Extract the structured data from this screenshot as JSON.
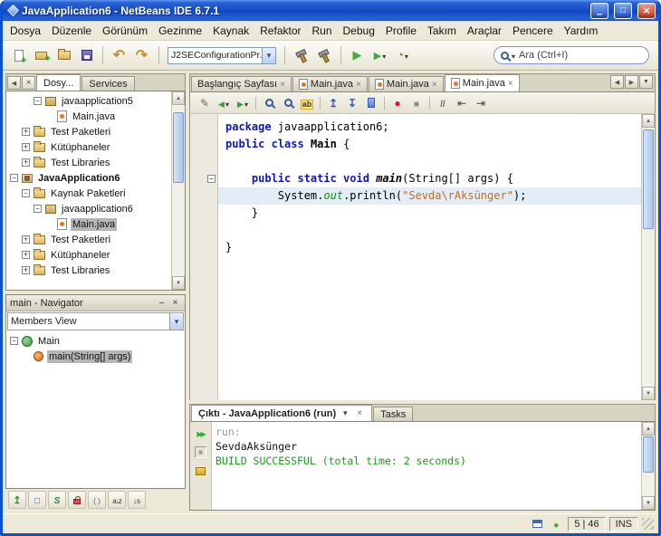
{
  "window": {
    "title": "JavaApplication6 - NetBeans IDE 6.7.1"
  },
  "menubar": [
    "Dosya",
    "Düzenle",
    "Görünüm",
    "Gezinme",
    "Kaynak",
    "Refaktor",
    "Run",
    "Debug",
    "Profile",
    "Takım",
    "Araçlar",
    "Pencere",
    "Yardım"
  ],
  "toolbar": {
    "config_value": "J2SEConfigurationPr...",
    "search_value": "Ara (Ctrl+I)",
    "buttons_left": [
      {
        "name": "new-file",
        "icon": "page-plus"
      },
      {
        "name": "new-project",
        "icon": "project-plus"
      },
      {
        "name": "open-project",
        "icon": "open-folder"
      },
      {
        "name": "save-all",
        "icon": "save"
      },
      {
        "sep": true
      },
      {
        "name": "undo",
        "icon": "undo"
      },
      {
        "name": "redo",
        "icon": "redo"
      }
    ],
    "buttons_right": [
      {
        "name": "build-project",
        "icon": "hammer"
      },
      {
        "name": "clean-build-project",
        "icon": "hammer2"
      },
      {
        "sep": true
      },
      {
        "name": "run-project",
        "icon": "run"
      },
      {
        "name": "debug-project",
        "icon": "debug",
        "arrow": true
      },
      {
        "name": "profile-project",
        "icon": "profile",
        "arrow": true
      }
    ]
  },
  "projects": {
    "tabs": [
      {
        "label": "Dosy...",
        "active": true
      },
      {
        "label": "Services",
        "active": false
      }
    ],
    "tree": [
      {
        "label": "javaapplication5",
        "icon": "pkg",
        "level": 2,
        "toggle": "minus"
      },
      {
        "label": "Main.java",
        "icon": "java",
        "level": 3
      },
      {
        "label": "Test Paketleri",
        "icon": "folder",
        "level": 1,
        "toggle": "plus"
      },
      {
        "label": "Kütüphaneler",
        "icon": "folder",
        "level": 1,
        "toggle": "plus"
      },
      {
        "label": "Test Libraries",
        "icon": "folder",
        "level": 1,
        "toggle": "plus"
      },
      {
        "label": "JavaApplication6",
        "icon": "project",
        "level": 0,
        "toggle": "minus",
        "bold": true
      },
      {
        "label": "Kaynak Paketleri",
        "icon": "folder",
        "level": 1,
        "toggle": "minus"
      },
      {
        "label": "javaapplication6",
        "icon": "pkg",
        "level": 2,
        "toggle": "minus"
      },
      {
        "label": "Main.java",
        "icon": "java",
        "level": 3,
        "selected": true
      },
      {
        "label": "Test Paketleri",
        "icon": "folder",
        "level": 1,
        "toggle": "plus"
      },
      {
        "label": "Kütüphaneler",
        "icon": "folder",
        "level": 1,
        "toggle": "plus"
      },
      {
        "label": "Test Libraries",
        "icon": "folder",
        "level": 1,
        "toggle": "plus"
      }
    ]
  },
  "navigator": {
    "title": "main - Navigator",
    "view": "Members View",
    "tree": [
      {
        "label": "Main",
        "icon": "class",
        "level": 0,
        "toggle": "minus"
      },
      {
        "label": "main(String[] args)",
        "icon": "method",
        "level": 1,
        "selected": true
      }
    ],
    "filters": [
      {
        "name": "show-inherited",
        "icon": "inherited"
      },
      {
        "name": "show-fields",
        "icon": "fields"
      },
      {
        "name": "show-static",
        "icon": "static"
      },
      {
        "name": "show-non-public",
        "icon": "lock"
      },
      {
        "name": "show-anonymous",
        "icon": "anon"
      },
      {
        "name": "sort-by-name",
        "icon": "sort-alpha"
      },
      {
        "name": "sort-by-source",
        "icon": "sort-pos"
      }
    ]
  },
  "editor": {
    "tabs": [
      {
        "label": "Başlangıç Sayfası",
        "icon": "none",
        "active": false
      },
      {
        "label": "Main.java",
        "icon": "java",
        "active": false
      },
      {
        "label": "Main.java",
        "icon": "java",
        "active": false
      },
      {
        "label": "Main.java",
        "icon": "java",
        "active": true
      }
    ],
    "code": [
      {
        "tokens": [
          {
            "t": "package",
            "c": "kw"
          },
          {
            "t": " javaapplication6;",
            "c": "pl"
          }
        ]
      },
      {
        "tokens": [
          {
            "t": "public class",
            "c": "kw"
          },
          {
            "t": " ",
            "c": "pl"
          },
          {
            "t": "Main",
            "c": "bold"
          },
          {
            "t": " {",
            "c": "pl"
          }
        ]
      },
      {
        "tokens": []
      },
      {
        "fold": "minus",
        "tokens": [
          {
            "t": "    ",
            "c": "pl"
          },
          {
            "t": "public static void",
            "c": "kw"
          },
          {
            "t": " ",
            "c": "pl"
          },
          {
            "t": "main",
            "c": "method"
          },
          {
            "t": "(String[] args) {",
            "c": "pl"
          }
        ]
      },
      {
        "highlight": true,
        "tokens": [
          {
            "t": "        System.",
            "c": "pl"
          },
          {
            "t": "out",
            "c": "field"
          },
          {
            "t": ".println(",
            "c": "pl"
          },
          {
            "t": "\"Sevda\\rAksünger\"",
            "c": "str"
          },
          {
            "t": ");",
            "c": "pl"
          }
        ]
      },
      {
        "tokens": [
          {
            "t": "    }",
            "c": "pl"
          }
        ]
      },
      {
        "tokens": []
      },
      {
        "tokens": [
          {
            "t": "}",
            "c": "pl"
          }
        ]
      }
    ]
  },
  "editor_toolbar": [
    {
      "name": "last-edited",
      "icon": "pencil"
    },
    {
      "name": "back",
      "icon": "nav-back",
      "arrow": true
    },
    {
      "name": "forward",
      "icon": "nav-fwd",
      "arrow": true
    },
    {
      "sep": true
    },
    {
      "name": "find-selection",
      "icon": "magnifier"
    },
    {
      "name": "find-next",
      "icon": "magnifier"
    },
    {
      "name": "toggle-highlight",
      "icon": "highlight"
    },
    {
      "sep": true
    },
    {
      "name": "previous-bookmark",
      "icon": "bm-up"
    },
    {
      "name": "next-bookmark",
      "icon": "bm-down"
    },
    {
      "name": "toggle-bookmark",
      "icon": "bookmark"
    },
    {
      "sep": true
    },
    {
      "name": "record-macro",
      "icon": "record"
    },
    {
      "name": "stop-macro",
      "icon": "stop"
    },
    {
      "sep": true
    },
    {
      "name": "comment",
      "icon": "comment"
    },
    {
      "name": "shift-left",
      "icon": "indent-left"
    },
    {
      "name": "shift-right",
      "icon": "indent-right"
    }
  ],
  "output": {
    "tabs": [
      {
        "label": "Çıktı - JavaApplication6 (run)",
        "active": true
      },
      {
        "label": "Tasks",
        "active": false
      }
    ],
    "side_buttons": [
      {
        "name": "rerun",
        "icon": "rerun"
      },
      {
        "name": "stop-build",
        "icon": "stopbox"
      },
      {
        "name": "ant-settings",
        "icon": "ant"
      }
    ],
    "lines": [
      {
        "text": "run:",
        "color": "#9a9a9a"
      },
      {
        "text": "SevdaAksünger",
        "color": "#111111"
      },
      {
        "text": "BUILD SUCCESSFUL (total time: 2 seconds)",
        "color": "#169e16"
      }
    ]
  },
  "statusbar": {
    "position": "5 | 46",
    "mode": "INS",
    "icons": [
      {
        "name": "output-window-status",
        "icon": "winblue"
      },
      {
        "name": "background-scan-status",
        "icon": "greendot"
      }
    ]
  }
}
